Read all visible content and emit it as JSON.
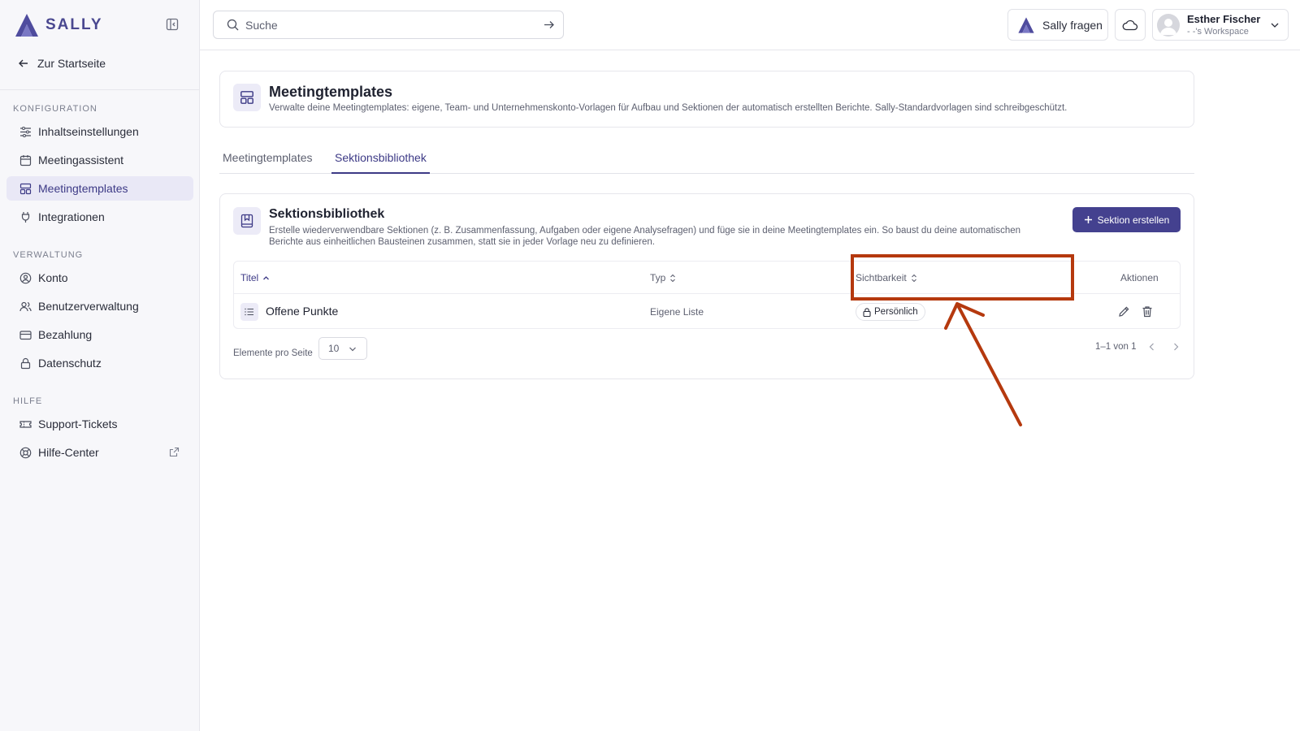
{
  "brand": {
    "name": "SALLY",
    "accent": "#44418f"
  },
  "sidebar": {
    "back_label": "Zur Startseite",
    "sections": [
      {
        "title": "KONFIGURATION",
        "items": [
          {
            "label": "Inhaltseinstellungen",
            "icon": "sliders-icon"
          },
          {
            "label": "Meetingassistent",
            "icon": "calendar-icon"
          },
          {
            "label": "Meetingtemplates",
            "icon": "template-icon",
            "active": true
          },
          {
            "label": "Integrationen",
            "icon": "plug-icon"
          }
        ]
      },
      {
        "title": "VERWALTUNG",
        "items": [
          {
            "label": "Konto",
            "icon": "user-circle-icon"
          },
          {
            "label": "Benutzerverwaltung",
            "icon": "users-icon"
          },
          {
            "label": "Bezahlung",
            "icon": "credit-card-icon"
          },
          {
            "label": "Datenschutz",
            "icon": "lock-icon"
          }
        ]
      },
      {
        "title": "HILFE",
        "items": [
          {
            "label": "Support-Tickets",
            "icon": "ticket-icon"
          },
          {
            "label": "Hilfe-Center",
            "icon": "lifebuoy-icon",
            "external": true
          }
        ]
      }
    ]
  },
  "topbar": {
    "search_placeholder": "Suche",
    "ask_label": "Sally fragen",
    "user_name": "Esther Fischer",
    "user_workspace": "- -'s Workspace"
  },
  "header": {
    "title": "Meetingtemplates",
    "description": "Verwalte deine Meetingtemplates: eigene, Team- und Unternehmenskonto-Vorlagen für Aufbau und Sektionen der automatisch erstellten Berichte. Sally-Standardvorlagen sind schreibgeschützt."
  },
  "tabs": [
    {
      "label": "Meetingtemplates",
      "active": false
    },
    {
      "label": "Sektionsbibliothek",
      "active": true
    }
  ],
  "library": {
    "title": "Sektionsbibliothek",
    "description": "Erstelle wiederverwendbare Sektionen (z. B. Zusammenfassung, Aufgaben oder eigene Analysefragen) und füge sie in deine Meetingtemplates ein. So baust du deine automatischen Berichte aus einheitlichen Bausteinen zusammen, statt sie in jeder Vorlage neu zu definieren.",
    "create_label": "Sektion erstellen",
    "columns": {
      "title": "Titel",
      "type": "Typ",
      "visibility": "Sichtbarkeit",
      "actions": "Aktionen"
    },
    "rows": [
      {
        "title": "Offene Punkte",
        "type": "Eigene Liste",
        "visibility": "Persönlich"
      }
    ],
    "pagination": {
      "per_page_label": "Elemente pro Seite",
      "per_page": "10",
      "range": "1–1 von 1"
    }
  },
  "annotation": {
    "color": "#b5390e",
    "target": "Sichtbarkeit"
  }
}
